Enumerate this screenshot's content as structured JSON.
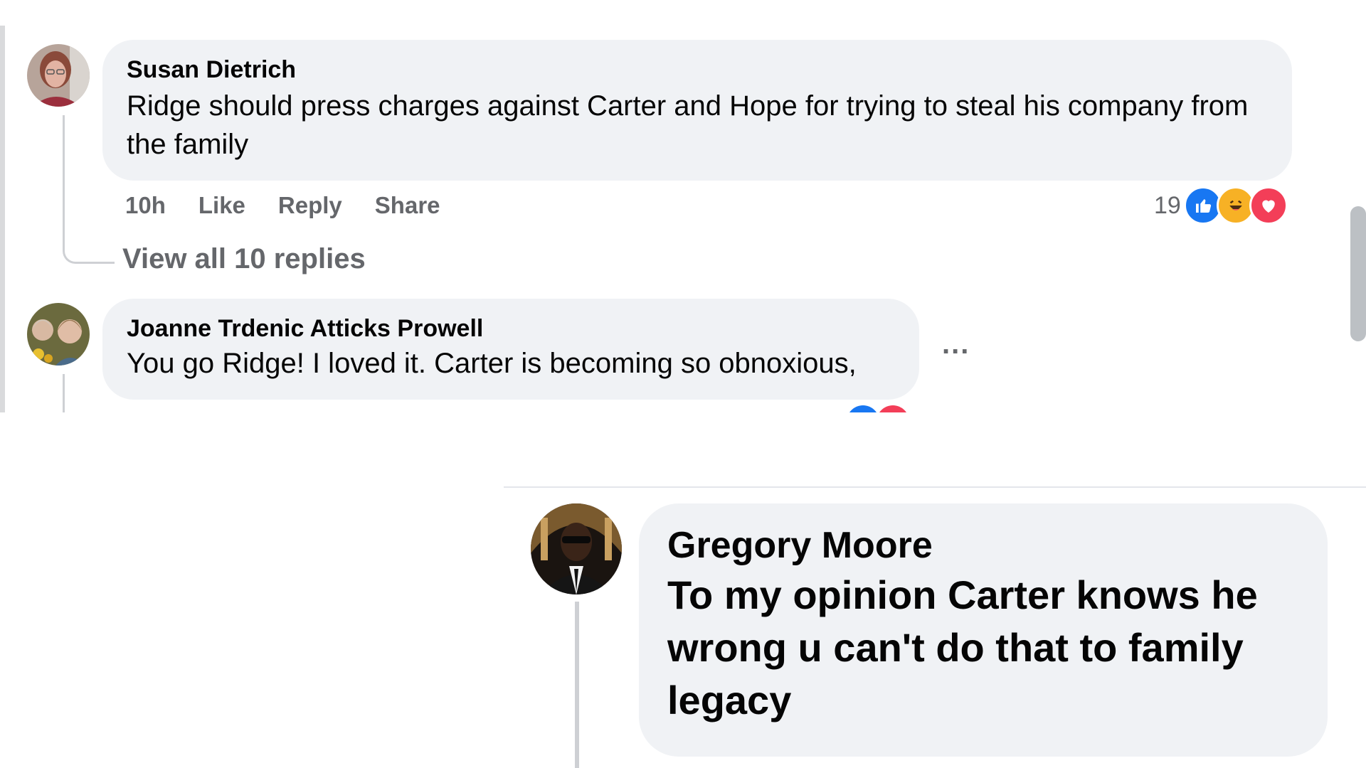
{
  "comments": [
    {
      "author": "Susan Dietrich",
      "text": "Ridge should press charges against Carter and Hope for trying to steal his company from the family",
      "time": "10h",
      "actions": {
        "like": "Like",
        "reply": "Reply",
        "share": "Share"
      },
      "reaction_count": "19",
      "reactions": [
        "like-icon",
        "haha-icon",
        "love-icon"
      ],
      "view_replies": "View all 10 replies"
    },
    {
      "author": "Joanne Trdenic Atticks Prowell",
      "text": "You go Ridge! I loved it. Carter is becoming so obnoxious,",
      "more_menu": "..."
    }
  ],
  "bottom_comment": {
    "author": "Gregory Moore",
    "text": "To my opinion Carter knows he wrong u can't do that to family legacy"
  },
  "colors": {
    "bubble": "#f0f2f5",
    "muted_text": "#65676b",
    "like_blue": "#1877f2",
    "love_red": "#f33e58",
    "haha_yellow": "#f7b125"
  }
}
